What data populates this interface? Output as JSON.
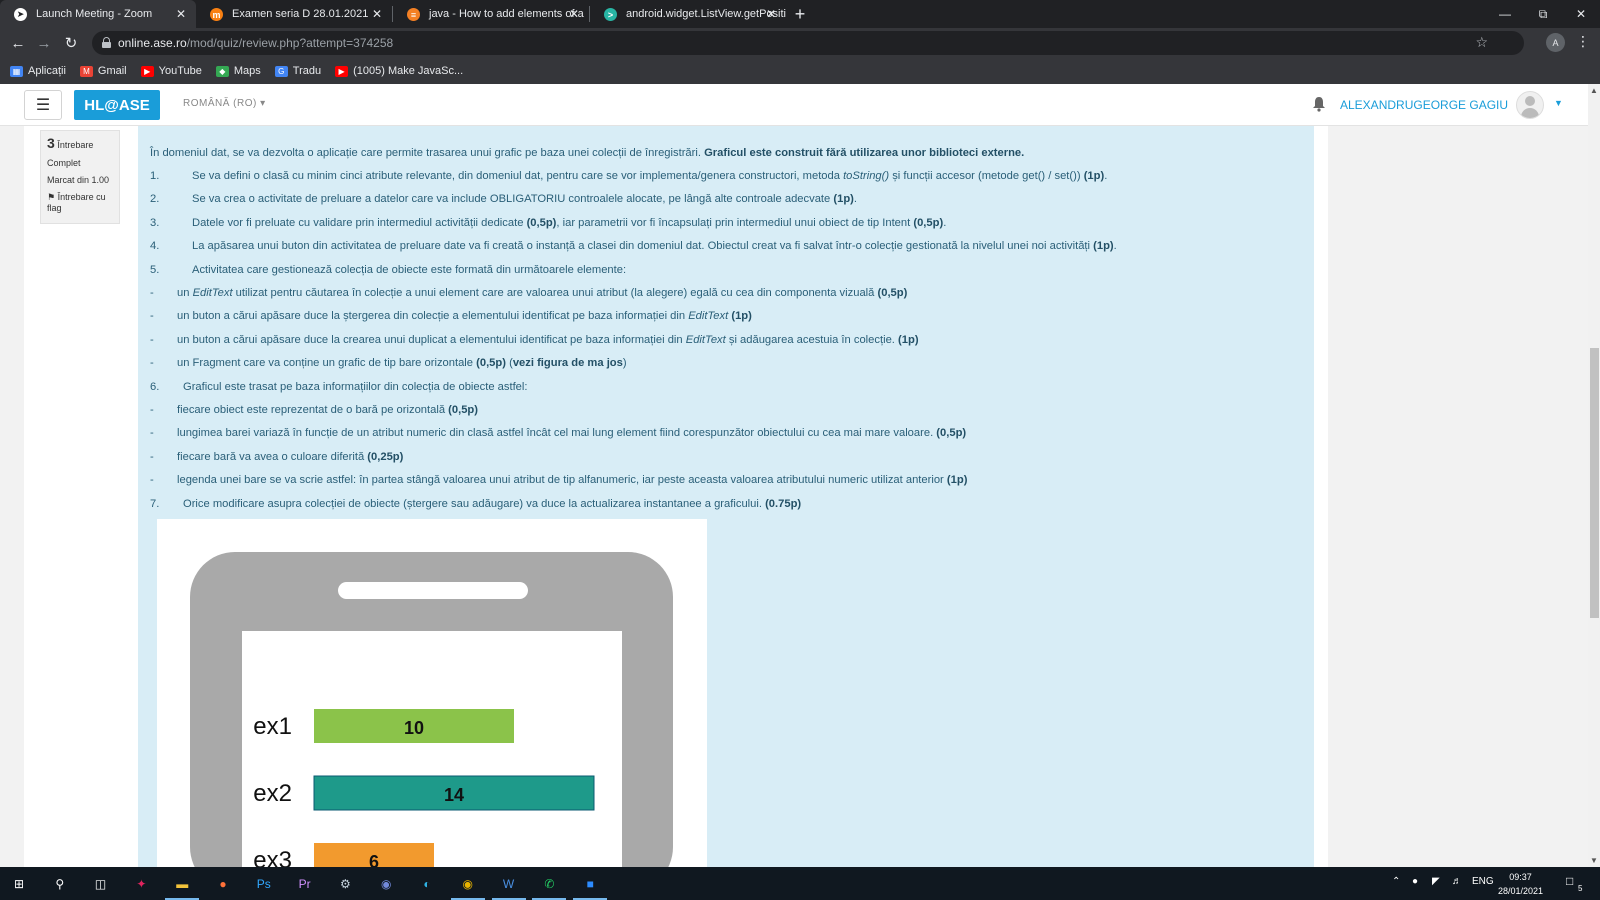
{
  "browser": {
    "tabs": [
      {
        "title": "Launch Meeting - Zoom",
        "icon": "zoom-icon",
        "active": true
      },
      {
        "title": "Examen seria D 28.01.2021",
        "icon": "moodle-icon",
        "active": false
      },
      {
        "title": "java - How to add elements of a",
        "icon": "stackoverflow-icon",
        "active": false
      },
      {
        "title": "android.widget.ListView.getPositi",
        "icon": "code-icon",
        "active": false
      }
    ],
    "new_tab": "+",
    "url_domain": "online.ase.ro",
    "url_path": "/mod/quiz/review.php?attempt=374258",
    "profile_letter": "A",
    "bookmarks": [
      {
        "label": "Aplicații",
        "icon": "apps-grid-icon"
      },
      {
        "label": "Gmail",
        "icon": "gmail-icon"
      },
      {
        "label": "YouTube",
        "icon": "youtube-icon"
      },
      {
        "label": "Maps",
        "icon": "maps-icon"
      },
      {
        "label": "Tradu",
        "icon": "translate-icon"
      },
      {
        "label": "(1005) Make JavaSc...",
        "icon": "youtube-icon"
      }
    ]
  },
  "navbar": {
    "brand": "HL@ASE",
    "language": "ROMÂNĂ (RO)",
    "user_name": "ALEXANDRUGEORGE GAGIU"
  },
  "question_info": {
    "number": "3",
    "label": "Întrebare",
    "state": "Complet",
    "mark": "Marcat din 1.00",
    "flag": "Întrebare cu flag"
  },
  "question": {
    "intro": "În domeniul dat, se va dezvolta o aplicație care permite trasarea unui grafic pe baza unei colecții de înregistrări.",
    "intro_bold": "Graficul este construit fără utilizarea unor biblioteci externe.",
    "items": [
      {
        "n": "1.",
        "parts": [
          [
            "Se va defini o clasă cu minim cinci atribute relevante, din domeniul dat, pentru care se vor implementa/genera constructori, metoda ",
            ""
          ],
          [
            "toString()",
            "i"
          ],
          [
            " și funcții accesor (metode get() / set()) ",
            ""
          ],
          [
            "(1p)",
            "b"
          ],
          [
            ".",
            ""
          ]
        ]
      },
      {
        "n": "2.",
        "parts": [
          [
            "Se va crea o activitate de preluare a datelor care va include OBLIGATORIU controalele alocate, pe lângă alte controale adecvate ",
            ""
          ],
          [
            "(1p)",
            "b"
          ],
          [
            ".",
            ""
          ]
        ]
      },
      {
        "n": "3.",
        "parts": [
          [
            "Datele vor fi preluate cu validare prin intermediul activității dedicate ",
            ""
          ],
          [
            "(0,5p)",
            "b"
          ],
          [
            ", iar parametrii vor fi încapsulați prin intermediul unui obiect de tip Intent ",
            ""
          ],
          [
            "(0,5p)",
            "b"
          ],
          [
            ".",
            ""
          ]
        ]
      },
      {
        "n": "4.",
        "parts": [
          [
            "La apăsarea unui buton din activitatea de preluare date va fi creată o instanță a clasei din domeniul dat. Obiectul creat va fi salvat într-o colecție gestionată la nivelul unei noi activități ",
            ""
          ],
          [
            "(1p)",
            "b"
          ],
          [
            ".",
            ""
          ]
        ]
      },
      {
        "n": "5.",
        "parts": [
          [
            "Activitatea care gestionează colecția de obiecte este formată din următoarele elemente:",
            ""
          ]
        ]
      },
      {
        "n": "-",
        "sub": true,
        "parts": [
          [
            "un ",
            ""
          ],
          [
            "EditText",
            "i"
          ],
          [
            " utilizat pentru căutarea în colecție a unui element care are valoarea unui atribut (la alegere) egală cu cea din componenta vizuală ",
            ""
          ],
          [
            "(0,5p)",
            "b"
          ]
        ]
      },
      {
        "n": "-",
        "sub": true,
        "parts": [
          [
            "un buton a cărui apăsare duce la ștergerea din colecție a elementului identificat pe baza informației din ",
            ""
          ],
          [
            "EditText",
            "i"
          ],
          [
            " ",
            ""
          ],
          [
            "(1p)",
            "b"
          ]
        ]
      },
      {
        "n": "-",
        "sub": true,
        "parts": [
          [
            "un buton a cărui apăsare duce la crearea unui duplicat a elementului identificat pe baza informației din ",
            ""
          ],
          [
            "EditText",
            "i"
          ],
          [
            " și adăugarea acestuia în colecție. ",
            ""
          ],
          [
            "(1p)",
            "b"
          ]
        ]
      },
      {
        "n": "-",
        "sub": true,
        "parts": [
          [
            "un Fragment care va conține un grafic de tip bare orizontale ",
            ""
          ],
          [
            "(0,5p)",
            "b"
          ],
          [
            " (",
            ""
          ],
          [
            "vezi figura de ma jos",
            "b"
          ],
          [
            ")",
            ""
          ]
        ]
      },
      {
        "n": "6.",
        "parts": [
          [
            "Graficul este trasat pe baza informațiilor din colecția de obiecte astfel:",
            ""
          ]
        ]
      },
      {
        "n": "-",
        "sub": true,
        "parts": [
          [
            "fiecare obiect este reprezentat de o bară pe orizontală ",
            ""
          ],
          [
            "(0,5p)",
            "b"
          ]
        ]
      },
      {
        "n": "-",
        "sub": true,
        "parts": [
          [
            "lungimea barei variază în funcție de un atribut numeric din clasă astfel încât cel mai lung element fiind corespunzător obiectului cu cea mai mare valoare. ",
            ""
          ],
          [
            "(0,5p)",
            "b"
          ]
        ]
      },
      {
        "n": "-",
        "sub": true,
        "parts": [
          [
            "fiecare bară va avea o culoare diferită ",
            ""
          ],
          [
            "(0,25p)",
            "b"
          ]
        ]
      },
      {
        "n": "-",
        "sub": true,
        "parts": [
          [
            "legenda unei bare se va scrie astfel: în partea stângă valoarea unui atribut de tip alfanumeric, iar peste aceasta valoarea atributului numeric utilizat anterior ",
            ""
          ],
          [
            "(1p)",
            "b"
          ]
        ]
      },
      {
        "n": "7.",
        "parts": [
          [
            "Orice modificare asupra colecției de obiecte (ștergere sau adăugare) va duce la actualizarea instantanee a graficului. ",
            ""
          ],
          [
            "(0.75p)",
            "b"
          ]
        ]
      }
    ]
  },
  "figure_bars": [
    {
      "label": "ex1",
      "value": 10,
      "color": "#8bc34a"
    },
    {
      "label": "ex2",
      "value": 14,
      "color": "#1e9a8a"
    },
    {
      "label": "ex3",
      "value": 6,
      "color": "#f29a2e"
    }
  ],
  "taskbar": {
    "icons": [
      "windows-start-icon",
      "search-icon",
      "task-view-icon",
      "app-icon",
      "file-explorer-icon",
      "firefox-icon",
      "photoshop-icon",
      "premiere-icon",
      "steam-icon",
      "discord-icon",
      "edge-icon",
      "chrome-icon",
      "word-icon",
      "whatsapp-icon",
      "zoom-icon"
    ],
    "language": "ENG",
    "time": "09:37",
    "date": "28/01/2021",
    "notification_count": "5"
  }
}
